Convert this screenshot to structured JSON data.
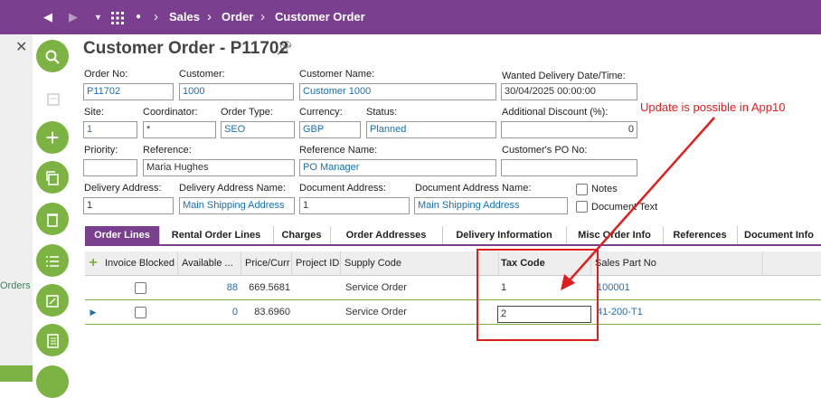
{
  "topbar": {
    "back_icon": "back-arrow-icon",
    "forward_icon": "forward-arrow-icon",
    "crumbs": [
      "Sales",
      "Order",
      "Customer Order"
    ]
  },
  "sidepanel": {
    "orders_label": "Orders"
  },
  "page": {
    "title": "Customer Order - P11702"
  },
  "form": {
    "order_no": {
      "label": "Order No:",
      "value": "P11702"
    },
    "customer": {
      "label": "Customer:",
      "value": "1000"
    },
    "customer_name": {
      "label": "Customer Name:",
      "value": "Customer 1000"
    },
    "wanted_delivery": {
      "label": "Wanted Delivery Date/Time:",
      "value": "30/04/2025 00:00:00"
    },
    "site": {
      "label": "Site:",
      "value": "1"
    },
    "coordinator": {
      "label": "Coordinator:",
      "value": "*"
    },
    "order_type": {
      "label": "Order Type:",
      "value": "SEO"
    },
    "currency": {
      "label": "Currency:",
      "value": "GBP"
    },
    "status": {
      "label": "Status:",
      "value": "Planned"
    },
    "additional_discount": {
      "label": "Additional Discount (%):",
      "value": "0"
    },
    "priority": {
      "label": "Priority:",
      "value": ""
    },
    "reference": {
      "label": "Reference:",
      "value": "Maria Hughes"
    },
    "reference_name": {
      "label": "Reference Name:",
      "value": "PO Manager"
    },
    "customer_po": {
      "label": "Customer's PO No:",
      "value": ""
    },
    "delivery_address": {
      "label": "Delivery Address:",
      "value": "1"
    },
    "delivery_address_name": {
      "label": "Delivery Address Name:",
      "value": "Main Shipping Address"
    },
    "document_address": {
      "label": "Document Address:",
      "value": "1"
    },
    "document_address_name": {
      "label": "Document Address Name:",
      "value": "Main Shipping Address"
    },
    "notes_label": "Notes",
    "document_text_label": "Document Text"
  },
  "tabs": [
    "Order Lines",
    "Rental Order Lines",
    "Charges",
    "Order Addresses",
    "Delivery Information",
    "Misc Order Info",
    "References",
    "Document Info"
  ],
  "grid": {
    "headers": [
      "Invoice Blocked",
      "Available ...",
      "Price/Curr",
      "Project ID",
      "Supply Code",
      "Tax Code",
      "Sales Part No"
    ],
    "rows": [
      {
        "available": "88",
        "price": "669.5681",
        "project": "",
        "supply": "Service Order",
        "tax": "1",
        "part": "100001"
      },
      {
        "available": "0",
        "price": "83.6960",
        "project": "",
        "supply": "Service Order",
        "tax": "2",
        "part": "41-200-T1"
      }
    ]
  },
  "annotation": {
    "text": "Update is possible in App10",
    "color": "#e21d1d"
  }
}
